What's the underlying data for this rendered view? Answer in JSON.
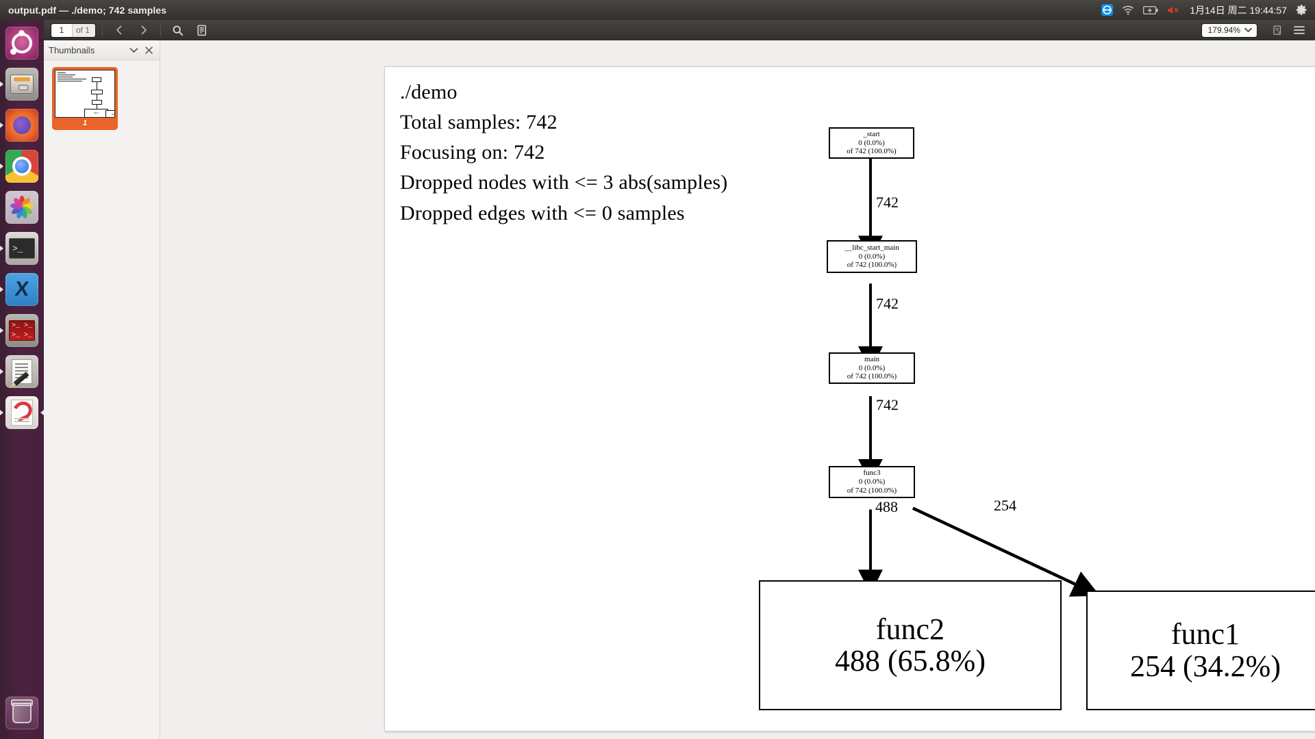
{
  "panel": {
    "title": "output.pdf — ./demo; 742 samples",
    "tray": {
      "teamviewer_icon": "teamviewer-icon",
      "wifi_icon": "wifi-icon",
      "battery_icon": "battery-icon",
      "volume_muted_icon": "volume-muted-icon",
      "clock": "1月14日 周二 19:44:57",
      "settings_icon": "gear-icon"
    }
  },
  "launcher": {
    "items": [
      {
        "name": "ubuntu-dash",
        "label": "Ubuntu Dash",
        "running": false
      },
      {
        "name": "files",
        "label": "Files",
        "running": true
      },
      {
        "name": "firefox",
        "label": "Firefox",
        "running": true
      },
      {
        "name": "chrome",
        "label": "Google Chrome",
        "running": true
      },
      {
        "name": "photos",
        "label": "Photos",
        "running": false
      },
      {
        "name": "terminal",
        "label": "Terminal",
        "running": true
      },
      {
        "name": "vscode",
        "label": "Visual Studio Code",
        "running": true
      },
      {
        "name": "red-terminal",
        "label": "Terminator",
        "running": true
      },
      {
        "name": "text-editor",
        "label": "Text Editor",
        "running": true
      },
      {
        "name": "document-viewer",
        "label": "Document Viewer",
        "running": true
      }
    ],
    "trash": {
      "name": "trash",
      "label": "Trash"
    }
  },
  "toolbar": {
    "page_current": "1",
    "page_total": "of 1",
    "prev_label": "Previous page",
    "next_label": "Next page",
    "find_label": "Find",
    "annotations_label": "Annotations",
    "zoom_value": "179.94%",
    "select_tool_label": "Select tool",
    "menu_label": "Main menu"
  },
  "sidebar": {
    "title": "Thumbnails",
    "collapse_label": "▾",
    "close_label": "✕",
    "thumbnails": [
      {
        "page_label": "1",
        "selected": true
      }
    ]
  },
  "document": {
    "header_lines": [
      "./demo",
      "Total samples: 742",
      "Focusing on: 742",
      "Dropped nodes with <= 3 abs(samples)",
      "Dropped edges with <= 0 samples"
    ],
    "graph": {
      "nodes": [
        {
          "id": "_start",
          "title": "_start",
          "self": "0 (0.0%)",
          "total": "of 742 (100.0%)",
          "size": "small"
        },
        {
          "id": "__libc_start_main",
          "title": "__libc_start_main",
          "self": "0 (0.0%)",
          "total": "of 742 (100.0%)",
          "size": "small"
        },
        {
          "id": "main",
          "title": "main",
          "self": "0 (0.0%)",
          "total": "of 742 (100.0%)",
          "size": "small"
        },
        {
          "id": "func3",
          "title": "func3",
          "self": "0 (0.0%)",
          "total": "of 742 (100.0%)",
          "size": "small"
        },
        {
          "id": "func2",
          "title": "func2",
          "self": "488 (65.8%)",
          "total": "",
          "size": "big"
        },
        {
          "id": "func1",
          "title": "func1",
          "self": "254 (34.2%)",
          "total": "",
          "size": "big"
        }
      ],
      "edges": [
        {
          "from": "_start",
          "to": "__libc_start_main",
          "label": "742"
        },
        {
          "from": "__libc_start_main",
          "to": "main",
          "label": "742"
        },
        {
          "from": "main",
          "to": "func3",
          "label": "742"
        },
        {
          "from": "func3",
          "to": "func2",
          "label": "488"
        },
        {
          "from": "func3",
          "to": "func1",
          "label": "254"
        }
      ]
    }
  }
}
